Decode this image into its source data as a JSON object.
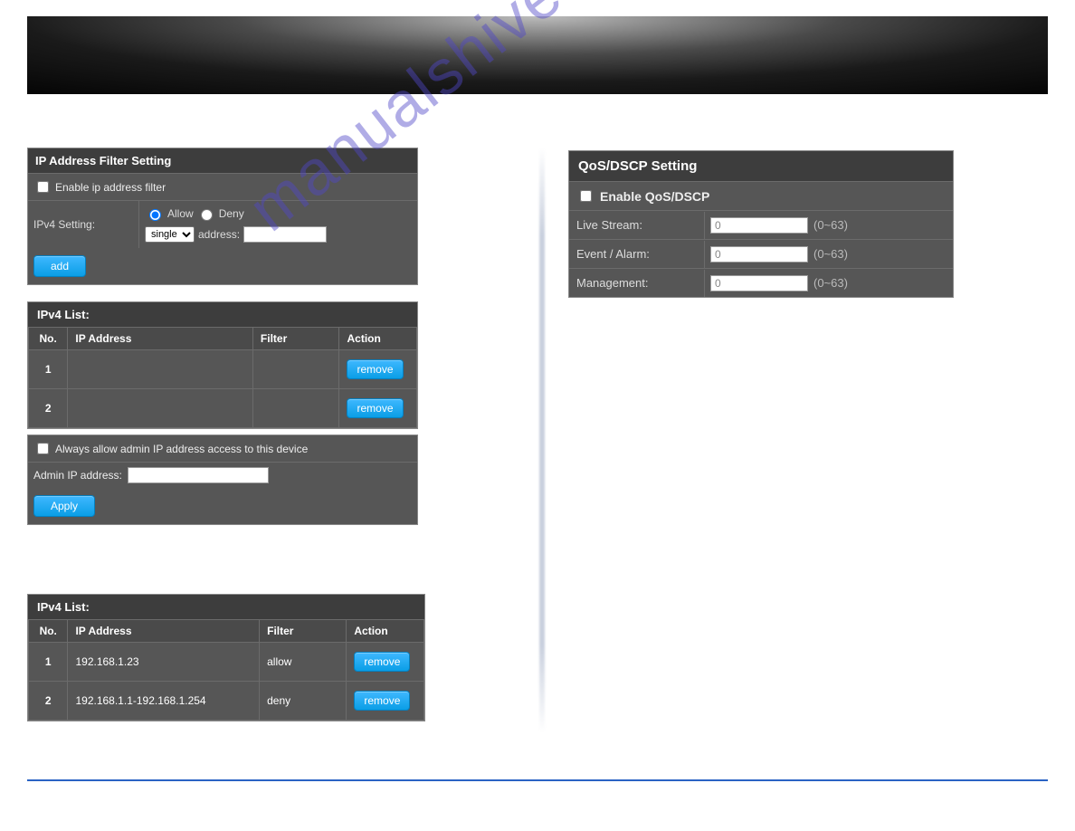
{
  "watermark": "manualshive.com",
  "ipfilter": {
    "title": "IP Address Filter Setting",
    "enable_label": "Enable ip address filter",
    "ipv4_label": "IPv4 Setting:",
    "allow_label": "Allow",
    "deny_label": "Deny",
    "mode_options": [
      "single"
    ],
    "mode_selected": "single",
    "address_label": "address:",
    "address_value": "",
    "add_btn": "add",
    "list_title": "IPv4 List:",
    "headers": {
      "no": "No.",
      "ip": "IP Address",
      "filter": "Filter",
      "action": "Action"
    },
    "rows": [
      {
        "no": "1",
        "ip": "",
        "filter": "",
        "remove": "remove"
      },
      {
        "no": "2",
        "ip": "",
        "filter": "",
        "remove": "remove"
      }
    ],
    "always_label": "Always allow admin IP address access to this device",
    "admin_ip_label": "Admin IP address:",
    "admin_ip_value": "",
    "apply_btn": "Apply"
  },
  "iplist2": {
    "title": "IPv4 List:",
    "headers": {
      "no": "No.",
      "ip": "IP Address",
      "filter": "Filter",
      "action": "Action"
    },
    "rows": [
      {
        "no": "1",
        "ip": "192.168.1.23",
        "filter": "allow",
        "remove": "remove"
      },
      {
        "no": "2",
        "ip": "192.168.1.1-192.168.1.254",
        "filter": "deny",
        "remove": "remove"
      }
    ]
  },
  "qos": {
    "title": "QoS/DSCP Setting",
    "enable_label": "Enable QoS/DSCP",
    "range_hint": "(0~63)",
    "rows": [
      {
        "label": "Live Stream:",
        "value": "0"
      },
      {
        "label": "Event / Alarm:",
        "value": "0"
      },
      {
        "label": "Management:",
        "value": "0"
      }
    ]
  }
}
